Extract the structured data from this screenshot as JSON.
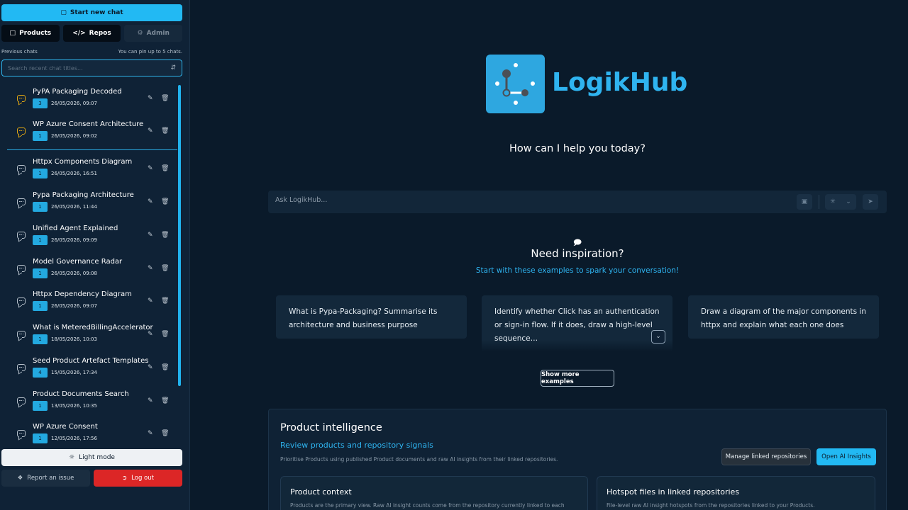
{
  "sidebar": {
    "new_chat": "Start new chat",
    "tabs": [
      {
        "label": "Products",
        "icon": "document-icon",
        "state": "active"
      },
      {
        "label": "Repos",
        "icon": "code-icon",
        "state": "active"
      },
      {
        "label": "Admin",
        "icon": "gear-icon",
        "state": "disabled"
      }
    ],
    "previous_chats_label": "Previous chats",
    "pin_hint": "You can pin up to 5 chats.",
    "search_placeholder": "Search recent chat titles...",
    "chats": [
      {
        "title": "PyPA Packaging Decoded",
        "count": "3",
        "date": "26/05/2026, 09:07",
        "pinned": true
      },
      {
        "title": "WP Azure Consent Architecture",
        "count": "1",
        "date": "26/05/2026, 09:02",
        "pinned": true
      },
      {
        "title": "Httpx Components Diagram",
        "count": "1",
        "date": "26/05/2026, 16:51",
        "pinned": false
      },
      {
        "title": "Pypa Packaging Architecture",
        "count": "1",
        "date": "26/05/2026, 11:44",
        "pinned": false
      },
      {
        "title": "Unified Agent Explained",
        "count": "1",
        "date": "26/05/2026, 09:09",
        "pinned": false
      },
      {
        "title": "Model Governance Radar",
        "count": "1",
        "date": "26/05/2026, 09:08",
        "pinned": false
      },
      {
        "title": "Httpx Dependency Diagram",
        "count": "1",
        "date": "26/05/2026, 09:07",
        "pinned": false
      },
      {
        "title": "What is MeteredBillingAccelerator",
        "count": "1",
        "date": "18/05/2026, 10:03",
        "pinned": false
      },
      {
        "title": "Seed Product Artefact Templates",
        "count": "4",
        "date": "15/05/2026, 17:34",
        "pinned": false
      },
      {
        "title": "Product Documents Search",
        "count": "1",
        "date": "13/05/2026, 10:35",
        "pinned": false
      },
      {
        "title": "WP Azure Consent",
        "count": "1",
        "date": "12/05/2026, 17:56",
        "pinned": false
      }
    ],
    "light_mode": "Light mode",
    "report_issue": "Report an issue",
    "log_out": "Log out"
  },
  "main": {
    "brand": "LogikHub",
    "prompt": "How can I help you today?",
    "ask_placeholder": "Ask LogikHub...",
    "inspiration_title": "Need inspiration?",
    "inspiration_sub": "Start with these examples to spark your conversation!",
    "examples": [
      "What is Pypa-Packaging? Summarise its architecture and business purpose",
      "Identify whether Click has an authentication or sign-in flow. If it does, draw a high-level sequence…",
      "Draw a diagram of the major components in httpx and explain what each one does"
    ],
    "show_more": "Show more examples",
    "panel": {
      "title": "Product intelligence",
      "subtitle": "Review products and repository signals",
      "description": "Prioritise Products using published Product documents and raw AI insights from their linked repositories.",
      "manage_button": "Manage linked repositories",
      "insights_button": "Open AI Insights",
      "cards": [
        {
          "title": "Product context",
          "desc": "Products are the primary view. Raw AI insight counts come from the repository currently linked to each"
        },
        {
          "title": "Hotspot files in linked repositories",
          "desc": "File-level raw AI insight hotspots from the repositories linked to your Products."
        }
      ]
    }
  },
  "colors": {
    "accent": "#22b9f3",
    "danger": "#dc2626",
    "pinned": "#e2a712",
    "background": "#0a1a2a"
  }
}
